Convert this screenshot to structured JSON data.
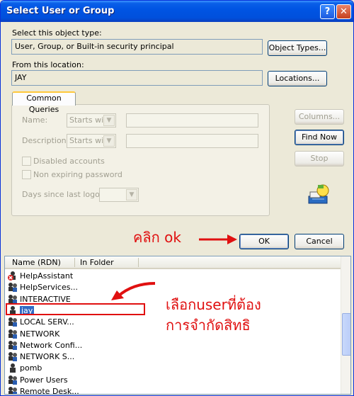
{
  "window": {
    "title": "Select User or Group",
    "help_glyph": "?",
    "close_glyph": "✕"
  },
  "object_type": {
    "label": "Select this object type:",
    "value": "User, Group, or Built-in security principal",
    "button": "Object Types..."
  },
  "location": {
    "label": "From this location:",
    "value": "JAY",
    "button": "Locations..."
  },
  "common_queries": {
    "tab_label": "Common Queries",
    "name_label": "Name:",
    "name_mode": "Starts with",
    "description_label": "Description:",
    "description_mode": "Starts with",
    "disabled_accounts": "Disabled accounts",
    "non_expiring_password": "Non expiring password",
    "days_since_logon": "Days since last logon:"
  },
  "side_buttons": {
    "columns": "Columns...",
    "find_now": "Find Now",
    "stop": "Stop"
  },
  "footer": {
    "ok": "OK",
    "cancel": "Cancel"
  },
  "results": {
    "columns": [
      "Name (RDN)",
      "In Folder"
    ],
    "rows": [
      {
        "name": "HelpAssistant",
        "icon": "disabled-user-icon",
        "selected": false
      },
      {
        "name": "HelpServices...",
        "icon": "group-icon",
        "selected": false
      },
      {
        "name": "INTERACTIVE",
        "icon": "group-icon",
        "selected": false
      },
      {
        "name": "jay",
        "icon": "user-icon",
        "selected": true
      },
      {
        "name": "LOCAL SERV...",
        "icon": "group-icon",
        "selected": false
      },
      {
        "name": "NETWORK",
        "icon": "group-icon",
        "selected": false
      },
      {
        "name": "Network Confi...",
        "icon": "group-icon",
        "selected": false
      },
      {
        "name": "NETWORK S...",
        "icon": "group-icon",
        "selected": false
      },
      {
        "name": "pomb",
        "icon": "user-icon",
        "selected": false
      },
      {
        "name": "Power Users",
        "icon": "group-icon",
        "selected": false
      },
      {
        "name": "Remote Desk...",
        "icon": "group-icon",
        "selected": false
      }
    ]
  },
  "annotations": {
    "click_ok": "คลิก ok",
    "select_user_line1": "เลือกuserที่ต้อง",
    "select_user_line2": "การจำกัดสิทธิ",
    "color": "#e01010"
  }
}
